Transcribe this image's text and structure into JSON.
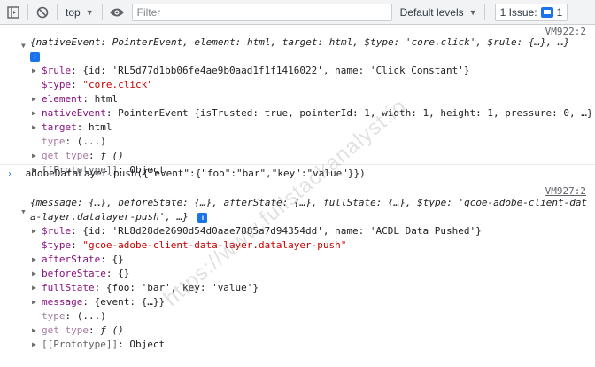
{
  "toolbar": {
    "context": "top",
    "filter_placeholder": "Filter",
    "levels": "Default levels",
    "issues": "1 Issue:",
    "issues_count": "1"
  },
  "msg1": {
    "source": "VM922:2",
    "summary": "{nativeEvent: PointerEvent, element: html, target: html, $type: 'core.click', $rule: {…}, …}",
    "rows": [
      {
        "key": "$rule",
        "sep": ": ",
        "val": "{id: 'RL5d77d1bb06fe4ae9b0aad1f1f1416022', name: 'Click Constant'}"
      },
      {
        "key": "$type",
        "sep": ": ",
        "val": "\"core.click\""
      },
      {
        "key": "element",
        "sep": ": ",
        "val": "html"
      },
      {
        "key": "nativeEvent",
        "sep": ": ",
        "val": "PointerEvent {isTrusted: true, pointerId: 1, width: 1, height: 1, pressure: 0, …}"
      },
      {
        "key": "target",
        "sep": ": ",
        "val": "html"
      },
      {
        "key": "type",
        "sep": ": ",
        "val": "(...)"
      },
      {
        "key": "get type",
        "sep": ": ",
        "val": "ƒ ()"
      },
      {
        "key": "[[Prototype]]",
        "sep": ": ",
        "val": "Object"
      }
    ]
  },
  "command": "adobeDataLayer.push({\"event\":{\"foo\":\"bar\",\"key\":\"value\"}})",
  "msg2": {
    "source": "VM927:2",
    "summary_line1": "{message: {…}, beforeState: {…}, afterState: {…}, fullState: {…}, $type: 'gcoe-adobe-client-dat",
    "summary_line2": "a-layer.datalayer-push', …}",
    "rows": [
      {
        "key": "$rule",
        "sep": ": ",
        "val": "{id: 'RL8d28de2690d54d0aae7885a7d94354dd', name: 'ACDL Data Pushed'}"
      },
      {
        "key": "$type",
        "sep": ": ",
        "val": "\"gcoe-adobe-client-data-layer.datalayer-push\""
      },
      {
        "key": "afterState",
        "sep": ": ",
        "val": "{}"
      },
      {
        "key": "beforeState",
        "sep": ": ",
        "val": "{}"
      },
      {
        "key": "fullState",
        "sep": ": ",
        "val": "{foo: 'bar', key: 'value'}"
      },
      {
        "key": "message",
        "sep": ": ",
        "val": "{event: {…}}"
      },
      {
        "key": "type",
        "sep": ": ",
        "val": "(...)"
      },
      {
        "key": "get type",
        "sep": ": ",
        "val": "ƒ ()"
      },
      {
        "key": "[[Prototype]]",
        "sep": ": ",
        "val": "Object"
      }
    ]
  },
  "watermark": "https://www.fullstackanalyst.io",
  "colors": {
    "key": "#881280",
    "string": "#c80000",
    "number": "#1a1aa6",
    "accent": "#1a73e8"
  }
}
